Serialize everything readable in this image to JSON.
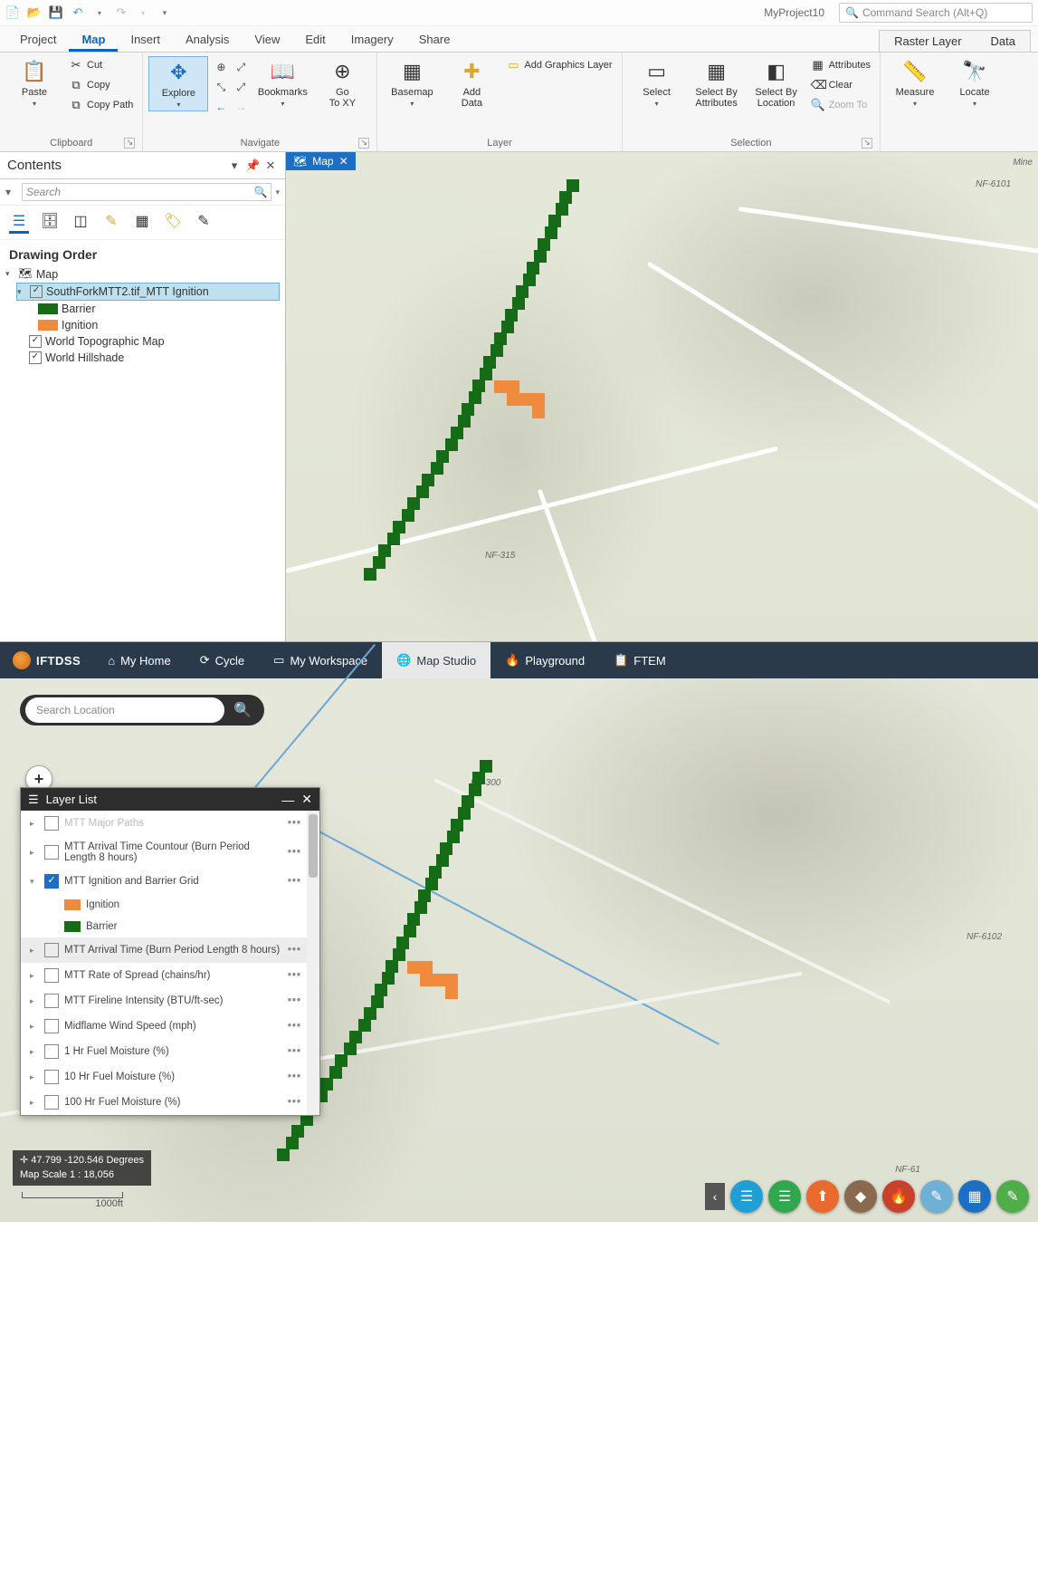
{
  "arc": {
    "project_name": "MyProject10",
    "command_search_placeholder": "Command Search (Alt+Q)",
    "main_tabs": [
      "Project",
      "Map",
      "Insert",
      "Analysis",
      "View",
      "Edit",
      "Imagery",
      "Share"
    ],
    "active_tab": "Map",
    "context_tabs": [
      "Raster Layer",
      "Data"
    ],
    "clipboard": {
      "paste": "Paste",
      "cut": "Cut",
      "copy": "Copy",
      "copy_path": "Copy Path",
      "group": "Clipboard"
    },
    "navigate": {
      "explore": "Explore",
      "bookmarks": "Bookmarks",
      "goto_xy": "Go\nTo XY",
      "group": "Navigate"
    },
    "layer": {
      "basemap": "Basemap",
      "add_data": "Add\nData",
      "add_graphics": "Add Graphics Layer",
      "group": "Layer"
    },
    "selection": {
      "select": "Select",
      "by_attr": "Select By\nAttributes",
      "by_loc": "Select By\nLocation",
      "attributes": "Attributes",
      "clear": "Clear",
      "zoom_to": "Zoom To",
      "group": "Selection"
    },
    "inquiry": {
      "measure": "Measure",
      "locate": "Locate"
    },
    "contents": {
      "title": "Contents",
      "search_placeholder": "Search",
      "drawing_order": "Drawing Order",
      "map_node": "Map",
      "layer_name": "SouthForkMTT2.tif_MTT Ignition",
      "legend_barrier": "Barrier",
      "legend_ignition": "Ignition",
      "topo": "World Topographic Map",
      "hillshade": "World Hillshade"
    },
    "map_tab_label": "Map",
    "road_labels": {
      "nf6101": "NF-6101",
      "nf315": "NF-315",
      "mine": "Mine"
    }
  },
  "iftdss": {
    "brand": "IFTDSS",
    "nav": [
      {
        "icon": "⌂",
        "label": "My Home"
      },
      {
        "icon": "⟳",
        "label": "Cycle"
      },
      {
        "icon": "▭",
        "label": "My Workspace"
      },
      {
        "icon": "🌐",
        "label": "Map Studio"
      },
      {
        "icon": "🔥",
        "label": "Playground"
      },
      {
        "icon": "📋",
        "label": "FTEM"
      }
    ],
    "active_nav": "Map Studio",
    "search_placeholder": "Search Location",
    "layer_list_title": "Layer List",
    "layers": [
      {
        "label": "MTT Major Paths",
        "checked": false,
        "dim": true
      },
      {
        "label": "MTT Arrival Time Countour (Burn Period Length 8 hours)",
        "checked": false
      },
      {
        "label": "MTT Ignition and Barrier Grid",
        "checked": true,
        "expanded": true,
        "children": [
          {
            "swatch": "#f08a3c",
            "label": "Ignition"
          },
          {
            "swatch": "#156b16",
            "label": "Barrier"
          }
        ]
      },
      {
        "label": "MTT Arrival Time (Burn Period Length 8 hours)",
        "checked": false,
        "hover": true
      },
      {
        "label": "MTT Rate of Spread (chains/hr)",
        "checked": false
      },
      {
        "label": "MTT Fireline Intensity (BTU/ft-sec)",
        "checked": false
      },
      {
        "label": "Midflame Wind Speed (mph)",
        "checked": false
      },
      {
        "label": "1 Hr Fuel Moisture (%)",
        "checked": false
      },
      {
        "label": "10 Hr Fuel Moisture (%)",
        "checked": false
      },
      {
        "label": "100 Hr Fuel Moisture (%)",
        "checked": false
      }
    ],
    "coords": "47.799 -120.546 Degrees",
    "scale": "Map Scale 1 : 18,056",
    "scalebar": "1000ft",
    "road_labels": {
      "nf300": "NF-300",
      "nf6102": "NF-6102",
      "nf61": "NF-61"
    },
    "tool_colors": [
      "#1e9fd8",
      "#2fa84f",
      "#e96a2c",
      "#8a6a4f",
      "#c7412b",
      "#6fb1d6",
      "#1d6fc4",
      "#4fae4a"
    ],
    "tool_icons": [
      "☰",
      "☰",
      "⬆",
      "◆",
      "🔥",
      "✎",
      "▦",
      "✎"
    ]
  }
}
